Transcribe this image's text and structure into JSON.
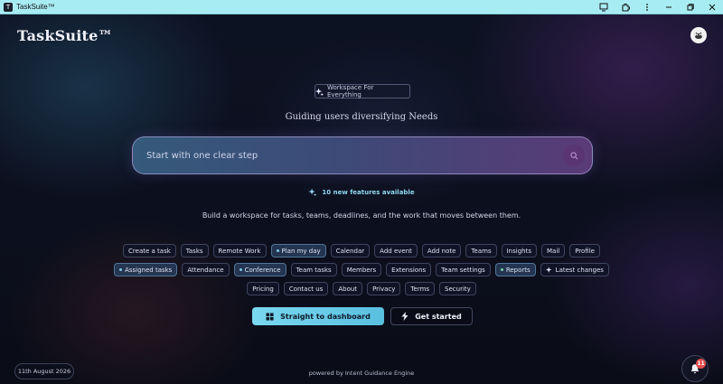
{
  "window": {
    "title": "TaskSuite™",
    "icon_glyph": "T"
  },
  "header": {
    "brand": "TaskSuite™",
    "avatar_icon": "avatar-icon"
  },
  "hero": {
    "badge_label": "Workspace For Everything",
    "tagline": "Guiding users diversifying Needs",
    "search_placeholder": "Start with one clear step",
    "features_label": "10 new features available",
    "description": "Build a workspace for tasks, teams, deadlines, and the work that moves between them."
  },
  "chips": {
    "row1": [
      {
        "label": "Create a task",
        "active": false
      },
      {
        "label": "Tasks",
        "active": false
      },
      {
        "label": "Remote Work",
        "active": false
      },
      {
        "label": "Plan my day",
        "active": true,
        "dot": "blue"
      },
      {
        "label": "Calendar",
        "active": false
      },
      {
        "label": "Add event",
        "active": false
      },
      {
        "label": "Add note",
        "active": false
      },
      {
        "label": "Teams",
        "active": false
      },
      {
        "label": "Insights",
        "active": false
      },
      {
        "label": "Mail",
        "active": false
      },
      {
        "label": "Profile",
        "active": false
      }
    ],
    "row2": [
      {
        "label": "Assigned tasks",
        "active": true,
        "dot": "blue"
      },
      {
        "label": "Attendance",
        "active": false
      },
      {
        "label": "Conference",
        "active": true,
        "dot": "blue"
      },
      {
        "label": "Team tasks",
        "active": false
      },
      {
        "label": "Members",
        "active": false
      },
      {
        "label": "Extensions",
        "active": false
      },
      {
        "label": "Team settings",
        "active": false
      },
      {
        "label": "Reports",
        "active": true,
        "dot": "green"
      },
      {
        "label": "Latest changes",
        "active": false,
        "sparkle": true
      }
    ],
    "row3": [
      {
        "label": "Pricing",
        "active": false
      },
      {
        "label": "Contact us",
        "active": false
      },
      {
        "label": "About",
        "active": false
      },
      {
        "label": "Privacy",
        "active": false
      },
      {
        "label": "Terms",
        "active": false
      },
      {
        "label": "Security",
        "active": false
      }
    ]
  },
  "actions": {
    "primary_label": "Straight to dashboard",
    "secondary_label": "Get started"
  },
  "footer": {
    "date": "11th August 2026",
    "powered_by": "powered by Intent Guidance Engine",
    "notification_count": "11"
  },
  "colors": {
    "titlebar": "#a8ecf3",
    "accent": "#7ad8ef",
    "badge_red": "#e34b4b"
  }
}
